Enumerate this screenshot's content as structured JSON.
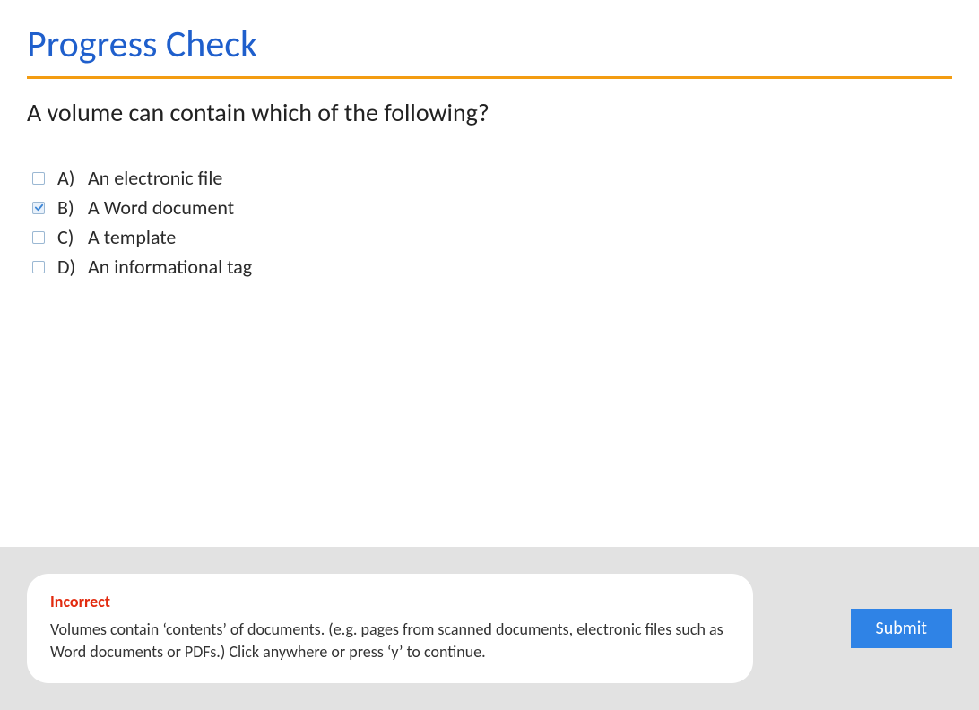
{
  "title": "Progress Check",
  "question": "A volume can contain which of the following?",
  "options": [
    {
      "letter": "A)",
      "text": "An electronic file",
      "checked": false
    },
    {
      "letter": "B)",
      "text": "A Word document",
      "checked": true
    },
    {
      "letter": "C)",
      "text": "A template",
      "checked": false
    },
    {
      "letter": "D)",
      "text": "An informational tag",
      "checked": false
    }
  ],
  "feedback": {
    "title": "Incorrect",
    "text": "Volumes contain ‘contents’ of documents. (e.g. pages from scanned documents, electronic files such as Word documents or PDFs.) Click anywhere or press ‘y’ to continue."
  },
  "submit_label": "Submit"
}
